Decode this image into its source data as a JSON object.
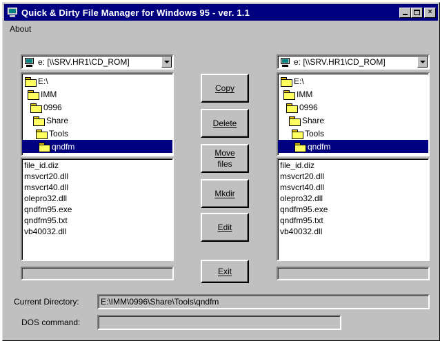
{
  "window": {
    "title": "Quick & Dirty File Manager for Windows 95 - ver. 1.1",
    "buttons": {
      "minimize": "_",
      "maximize": "□",
      "close": "×"
    }
  },
  "menu": [
    "About"
  ],
  "left": {
    "drive": "e: [\\\\SRV.HR1\\CD_ROM]",
    "folders": [
      "E:\\",
      "IMM",
      "0996",
      "Share",
      "Tools",
      "qndfm"
    ],
    "selected_folder": "qndfm",
    "files": [
      "file_id.diz",
      "msvcrt20.dll",
      "msvcrt40.dll",
      "olepro32.dll",
      "qndfm95.exe",
      "qndfm95.txt",
      "vb40032.dll"
    ],
    "status": ""
  },
  "right": {
    "drive": "e: [\\\\SRV.HR1\\CD_ROM]",
    "folders": [
      "E:\\",
      "IMM",
      "0996",
      "Share",
      "Tools",
      "qndfm"
    ],
    "selected_folder": "qndfm",
    "files": [
      "file_id.diz",
      "msvcrt20.dll",
      "msvcrt40.dll",
      "olepro32.dll",
      "qndfm95.exe",
      "qndfm95.txt",
      "vb40032.dll"
    ],
    "status": ""
  },
  "actions": {
    "copy": "Copy",
    "delete": "Delete",
    "move_line1": "Move",
    "move_line2": "files",
    "mkdir": "Mkdir",
    "edit": "Edit",
    "exit": "Exit"
  },
  "bottom": {
    "current_directory_label": "Current Directory:",
    "current_directory_value": "E:\\IMM\\0996\\Share\\Tools\\qndfm",
    "dos_command_label": "DOS command:",
    "dos_command_value": ""
  },
  "colors": {
    "face": "#c0c0c0",
    "titlebar": "#000080",
    "selection": "#000080",
    "window_bg": "#ffffff"
  }
}
